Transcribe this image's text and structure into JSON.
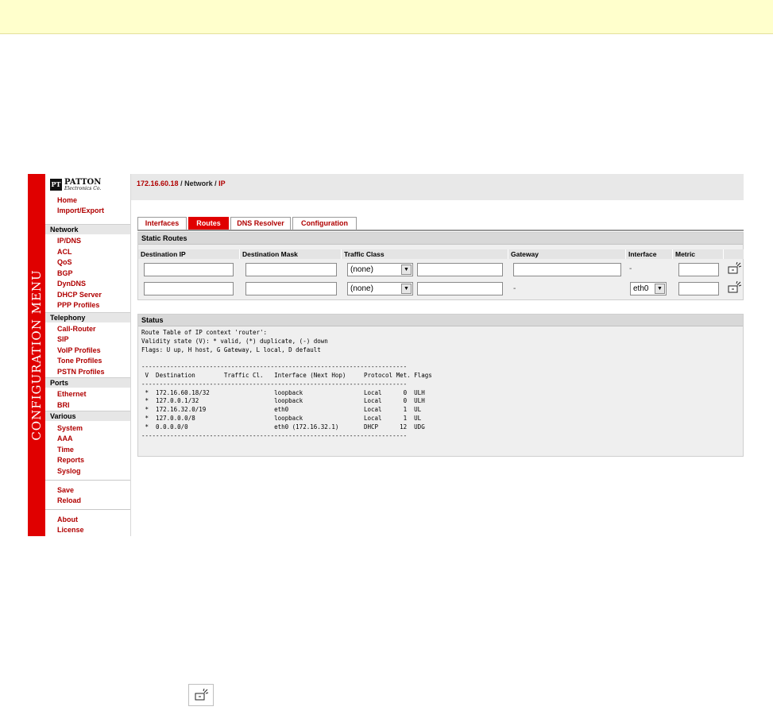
{
  "sidebar": {
    "menu_title": "CONFIGURATION MENU",
    "logo": {
      "mark": "PT",
      "name": "PATTON",
      "sub": "Electronics Co."
    },
    "top_links": [
      "Home",
      "Import/Export"
    ],
    "sections": [
      {
        "title": "Network",
        "items": [
          "IP/DNS",
          "ACL",
          "QoS",
          "BGP",
          "DynDNS",
          "DHCP Server",
          "PPP Profiles"
        ]
      },
      {
        "title": "Telephony",
        "items": [
          "Call-Router",
          "SIP",
          "VoIP Profiles",
          "Tone Profiles",
          "PSTN Profiles"
        ]
      },
      {
        "title": "Ports",
        "items": [
          "Ethernet",
          "BRI"
        ]
      },
      {
        "title": "Various",
        "items": [
          "System",
          "AAA",
          "Time",
          "Reports",
          "Syslog"
        ]
      }
    ],
    "actions": [
      "Save",
      "Reload"
    ],
    "footer": [
      "About",
      "License"
    ]
  },
  "breadcrumb": {
    "host": "172.16.60.18",
    "sep1": " / ",
    "section": "Network",
    "sep2": " / ",
    "page": "IP"
  },
  "tabs": [
    {
      "label": "Interfaces",
      "active": false
    },
    {
      "label": "Routes",
      "active": true
    },
    {
      "label": "DNS Resolver",
      "active": false
    },
    {
      "label": "Configuration",
      "active": false
    }
  ],
  "static_routes": {
    "title": "Static Routes",
    "columns": [
      "Destination IP",
      "Destination Mask",
      "Traffic Class",
      "Gateway",
      "Interface",
      "Metric"
    ],
    "rows": [
      {
        "dest_ip": "",
        "dest_mask": "",
        "traffic_class": "(none)",
        "class_extra": "",
        "gateway": "",
        "interface": "-",
        "metric": ""
      },
      {
        "dest_ip": "",
        "dest_mask": "",
        "traffic_class": "(none)",
        "class_extra": "",
        "gateway": "-",
        "interface": "eth0",
        "metric": ""
      }
    ]
  },
  "status": {
    "title": "Status",
    "text": "Route Table of IP context 'router':\nValidity state (V): * valid, (*) duplicate, (-) down\nFlags: U up, H host, G Gateway, L local, D default\n\n--------------------------------------------------------------------------\n V  Destination        Traffic Cl.   Interface (Next Hop)     Protocol Met. Flags\n--------------------------------------------------------------------------\n *  172.16.60.18/32                  loopback                 Local      0  ULH\n *  127.0.0.1/32                     loopback                 Local      0  ULH\n *  172.16.32.0/19                   eth0                     Local      1  UL\n *  127.0.0.0/8                      loopback                 Local      1  UL\n *  0.0.0.0/0                        eth0 (172.16.32.1)       DHCP      12  UDG\n--------------------------------------------------------------------------"
  },
  "icons": {
    "add_route": "add-route-icon"
  },
  "colors": {
    "brand_red": "#e00000",
    "link_red": "#b00000",
    "top_band": "#ffffcc"
  }
}
